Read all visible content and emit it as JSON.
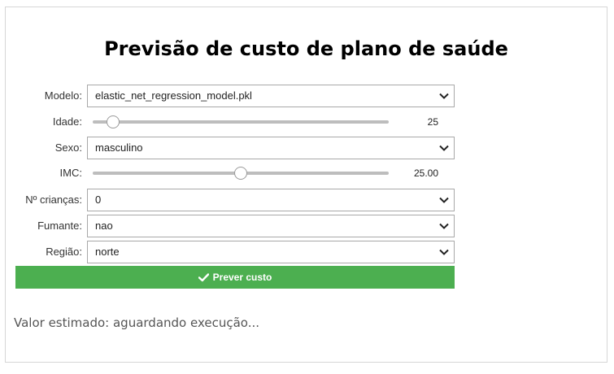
{
  "title": "Previsão de custo de plano de saúde",
  "form": {
    "modelo": {
      "label": "Modelo:",
      "value": "elastic_net_regression_model.pkl"
    },
    "idade": {
      "label": "Idade:",
      "readout": "25",
      "level": 0.07
    },
    "sexo": {
      "label": "Sexo:",
      "value": "masculino"
    },
    "imc": {
      "label": "IMC:",
      "readout": "25.00",
      "level": 0.5
    },
    "criancas": {
      "label": "Nº crianças:",
      "value": "0"
    },
    "fumante": {
      "label": "Fumante:",
      "value": "nao"
    },
    "regiao": {
      "label": "Região:",
      "value": "norte"
    }
  },
  "submit": {
    "label": "Prever custo",
    "icon": "check-icon",
    "color": "#4caf50"
  },
  "result": {
    "text": "Valor estimado: aguardando execução..."
  }
}
